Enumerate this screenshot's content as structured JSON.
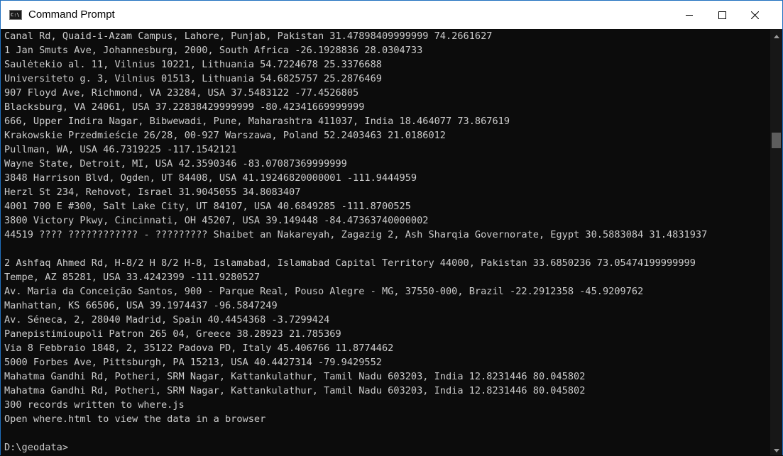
{
  "window": {
    "title": "Command Prompt",
    "icon_text": "C:\\",
    "controls": {
      "minimize": "minimize-icon",
      "maximize": "maximize-icon",
      "close": "close-icon"
    }
  },
  "console": {
    "lines": [
      "Canal Rd, Quaid-i-Azam Campus, Lahore, Punjab, Pakistan 31.47898409999999 74.2661627",
      "1 Jan Smuts Ave, Johannesburg, 2000, South Africa -26.1928836 28.0304733",
      "Saulėtekio al. 11, Vilnius 10221, Lithuania 54.7224678 25.3376688",
      "Universiteto g. 3, Vilnius 01513, Lithuania 54.6825757 25.2876469",
      "907 Floyd Ave, Richmond, VA 23284, USA 37.5483122 -77.4526805",
      "Blacksburg, VA 24061, USA 37.22838429999999 -80.42341669999999",
      "666, Upper Indira Nagar, Bibwewadi, Pune, Maharashtra 411037, India 18.464077 73.867619",
      "Krakowskie Przedmieście 26/28, 00-927 Warszawa, Poland 52.2403463 21.0186012",
      "Pullman, WA, USA 46.7319225 -117.1542121",
      "Wayne State, Detroit, MI, USA 42.3590346 -83.07087369999999",
      "3848 Harrison Blvd, Ogden, UT 84408, USA 41.19246820000001 -111.9444959",
      "Herzl St 234, Rehovot, Israel 31.9045055 34.8083407",
      "4001 700 E #300, Salt Lake City, UT 84107, USA 40.6849285 -111.8700525",
      "3800 Victory Pkwy, Cincinnati, OH 45207, USA 39.149448 -84.47363740000002",
      "44519 ???? ???????????? - ????????? Shaibet an Nakareyah, Zagazig 2, Ash Sharqia Governorate, Egypt 30.5883084 31.4831937",
      "",
      "2 Ashfaq Ahmed Rd, H-8/2 H 8/2 H-8, Islamabad, Islamabad Capital Territory 44000, Pakistan 33.6850236 73.05474199999999",
      "Tempe, AZ 85281, USA 33.4242399 -111.9280527",
      "Av. Maria da Conceição Santos, 900 - Parque Real, Pouso Alegre - MG, 37550-000, Brazil -22.2912358 -45.9209762",
      "Manhattan, KS 66506, USA 39.1974437 -96.5847249",
      "Av. Séneca, 2, 28040 Madrid, Spain 40.4454368 -3.7299424",
      "Panepistimioupoli Patron 265 04, Greece 38.28923 21.785369",
      "Via 8 Febbraio 1848, 2, 35122 Padova PD, Italy 45.406766 11.8774462",
      "5000 Forbes Ave, Pittsburgh, PA 15213, USA 40.4427314 -79.9429552",
      "Mahatma Gandhi Rd, Potheri, SRM Nagar, Kattankulathur, Tamil Nadu 603203, India 12.8231446 80.045802",
      "Mahatma Gandhi Rd, Potheri, SRM Nagar, Kattankulathur, Tamil Nadu 603203, India 12.8231446 80.045802",
      "300 records written to where.js",
      "Open where.html to view the data in a browser",
      "",
      "D:\\geodata>"
    ]
  },
  "colors": {
    "background": "#0c0c0c",
    "foreground": "#cccccc",
    "titlebar": "#ffffff",
    "scrollbar_track": "#171717",
    "scrollbar_thumb": "#5d5d5d"
  }
}
